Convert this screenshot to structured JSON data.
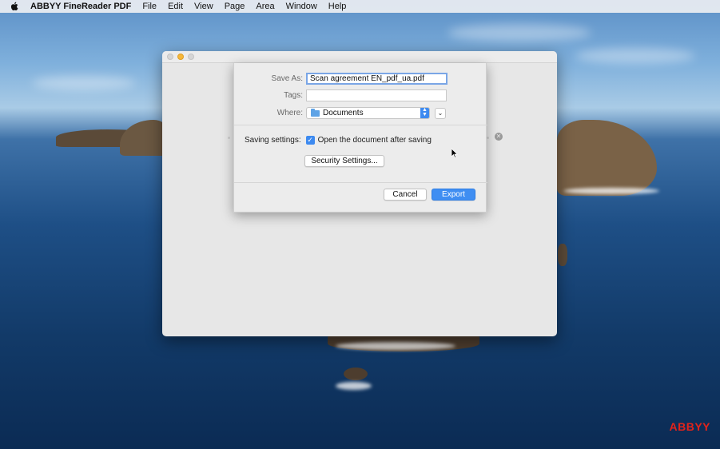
{
  "menubar": {
    "app_name": "ABBYY FineReader PDF",
    "items": [
      "File",
      "Edit",
      "View",
      "Page",
      "Area",
      "Window",
      "Help"
    ]
  },
  "save_dialog": {
    "save_as_label": "Save As:",
    "filename": "Scan agreement EN_pdf_ua.pdf",
    "tags_label": "Tags:",
    "tags_value": "",
    "where_label": "Where:",
    "where_value": "Documents",
    "saving_settings_label": "Saving settings:",
    "open_after_saving_label": "Open the document after saving",
    "open_after_saving_checked": true,
    "security_button": "Security Settings...",
    "cancel_button": "Cancel",
    "export_button": "Export"
  },
  "brand": {
    "text": "ABBYY",
    "color": "#e2231a"
  },
  "colors": {
    "accent": "#3f8ef2",
    "traffic_minimize": "#f6b73a"
  },
  "icons": {
    "apple": "apple-logo-icon",
    "folder": "folder-icon",
    "stepper": "up-down-chevron-icon",
    "expand": "chevron-down-icon",
    "checkbox": "checkmark-icon",
    "close": "close-circle-icon",
    "cursor": "mouse-pointer-icon"
  }
}
